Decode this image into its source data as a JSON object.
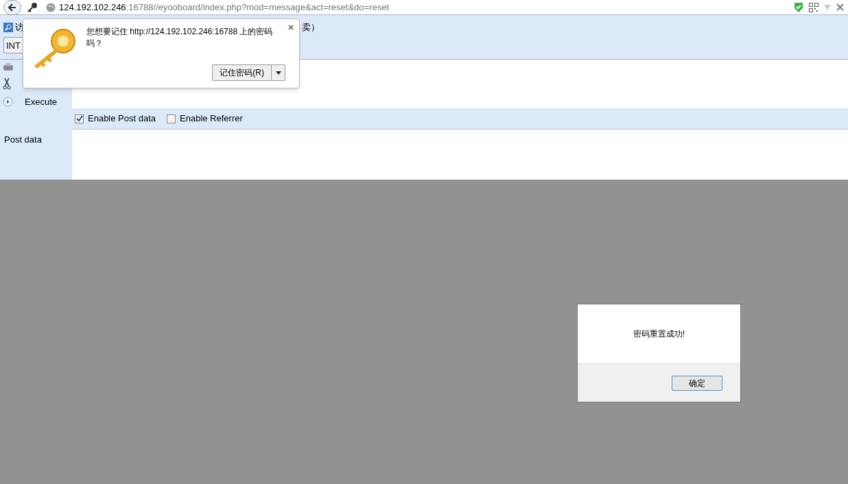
{
  "address_bar": {
    "host": "124.192.102.246",
    "rest": ":16788//eyooboard/index.php?mod=message&act=reset&do=reset"
  },
  "hackbar": {
    "menu_text": "访",
    "menu_text_tail": "卖）",
    "select": "INT",
    "execute": "Execute",
    "post_label": "Post data",
    "options": [
      {
        "label": "Enable Post data",
        "checked": true
      },
      {
        "label": "Enable Referrer",
        "checked": false
      }
    ]
  },
  "password_prompt": {
    "message": "您想要记住 http://124.192.102.246:16788 上的密码吗？",
    "button": "记住密码(R)"
  },
  "alert": {
    "message": "密码重置成功!",
    "button": "确定"
  }
}
